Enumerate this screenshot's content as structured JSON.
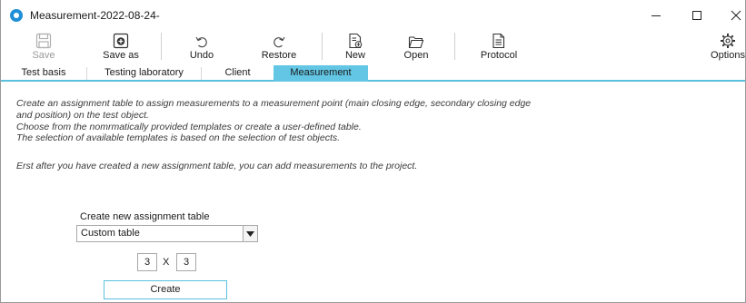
{
  "window": {
    "title": "Measurement-2022-08-24-"
  },
  "toolbar": {
    "save_label": "Save",
    "save_as_label": "Save as",
    "undo_label": "Undo",
    "restore_label": "Restore",
    "new_label": "New",
    "open_label": "Open",
    "protocol_label": "Protocol",
    "options_label": "Options"
  },
  "tabs": [
    {
      "label": "Test basis"
    },
    {
      "label": "Testing laboratory"
    },
    {
      "label": "Client"
    },
    {
      "label": "Measurement"
    }
  ],
  "content": {
    "description_lines": [
      "Create an assignment table to assign measurements to a measurement point (main closing edge, secondary closing edge",
      "and position) on the test object.",
      "Choose from the nomrmatically provided templates or create a user-defined table.",
      "The selection of available templates is based on the selection of test objects."
    ],
    "note": "Erst after you have created a new assignment table, you can add measurements to the project."
  },
  "form": {
    "label": "Create new assignment table",
    "selected_option": "Custom table",
    "rows": "3",
    "separator": "X",
    "columns": "3",
    "create_label": "Create"
  },
  "colors": {
    "accent": "#62c6e4",
    "brand_icon": "#1f8fd6"
  }
}
